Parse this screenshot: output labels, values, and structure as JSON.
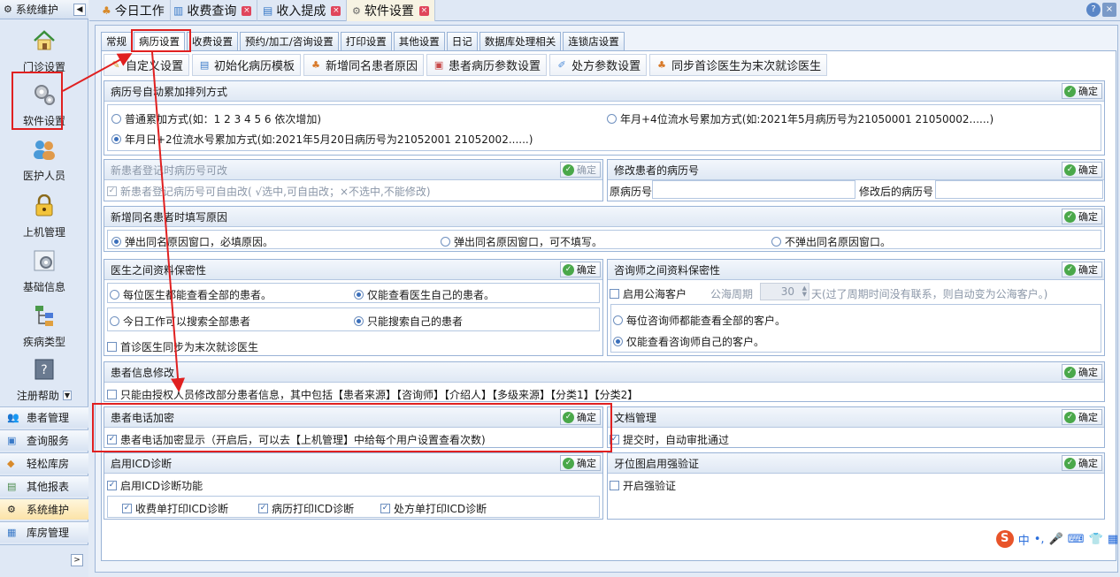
{
  "nav": {
    "header": "系统维护",
    "items": [
      {
        "label": "门诊设置",
        "icon": "house-icon"
      },
      {
        "label": "软件设置",
        "icon": "gears-icon"
      },
      {
        "label": "医护人员",
        "icon": "people-icon"
      },
      {
        "label": "上机管理",
        "icon": "lock-icon"
      },
      {
        "label": "基础信息",
        "icon": "gear-icon"
      },
      {
        "label": "疾病类型",
        "icon": "tree-icon"
      },
      {
        "label": "注册帮助",
        "icon": "help-icon"
      }
    ],
    "groups": [
      "患者管理",
      "查询服务",
      "轻松库房",
      "其他报表",
      "系统维护",
      "库房管理"
    ]
  },
  "tabs": [
    {
      "label": "今日工作"
    },
    {
      "label": "收费查询"
    },
    {
      "label": "收入提成"
    },
    {
      "label": "软件设置"
    }
  ],
  "subtabs": [
    "常规",
    "病历设置",
    "收费设置",
    "预约/加工/咨询设置",
    "打印设置",
    "其他设置",
    "日记",
    "数据库处理相关",
    "连锁店设置"
  ],
  "toolbar": [
    "自定义设置",
    "初始化病历模板",
    "新增同名患者原因",
    "患者病历参数设置",
    "处方参数设置",
    "同步首诊医生为末次就诊医生"
  ],
  "ok": "确定",
  "s1": {
    "title": "病历号自动累加排列方式",
    "opt1": "普通累加方式(如：1 2 3 4 5 6 依次增加)",
    "opt2": "年月+4位流水号累加方式(如:2021年5月病历号为21050001 21050002......)",
    "opt3": "年月日+2位流水号累加方式(如:2021年5月20日病历号为21052001 21052002......)"
  },
  "s2": {
    "title": "新患者登记时病历号可改",
    "opt": "新患者登记病历号可自由改( √选中,可自由改；×不选中,不能修改)"
  },
  "s3": {
    "title": "修改患者的病历号",
    "orig": "原病历号",
    "new": "修改后的病历号"
  },
  "s4": {
    "title": "新增同名患者时填写原因",
    "opt1": "弹出同名原因窗口，必填原因。",
    "opt2": "弹出同名原因窗口，可不填写。",
    "opt3": "不弹出同名原因窗口。"
  },
  "s5": {
    "title": "医生之间资料保密性",
    "opt1": "每位医生都能查看全部的患者。",
    "opt2": "仅能查看医生自己的患者。",
    "opt3": "今日工作可以搜索全部患者",
    "opt4": "只能搜索自己的患者",
    "opt5": "首诊医生同步为末次就诊医生"
  },
  "s6": {
    "title": "咨询师之间资料保密性",
    "sea": "启用公海客户",
    "period": "公海周期",
    "days": "30",
    "tail": "天(过了周期时间没有联系，则自动变为公海客户。)",
    "opt1": "每位咨询师都能查看全部的客户。",
    "opt2": "仅能查看咨询师自己的客户。"
  },
  "s7": {
    "title": "患者信息修改",
    "opt": "只能由授权人员修改部分患者信息，其中包括【患者来源】【咨询师】【介绍人】【多级来源】【分类1】【分类2】"
  },
  "s8": {
    "title": "患者电话加密",
    "opt": "患者电话加密显示（开启后，可以去【上机管理】中给每个用户设置查看次数)"
  },
  "s9": {
    "title": "文档管理",
    "opt": "提交时，自动审批通过"
  },
  "s10": {
    "title": "启用ICD诊断",
    "opt": "启用ICD诊断功能",
    "c1": "收费单打印ICD诊断",
    "c2": "病历打印ICD诊断",
    "c3": "处方单打印ICD诊断"
  },
  "s11": {
    "title": "牙位图启用强验证",
    "opt": "开启强验证"
  },
  "ime": "中"
}
